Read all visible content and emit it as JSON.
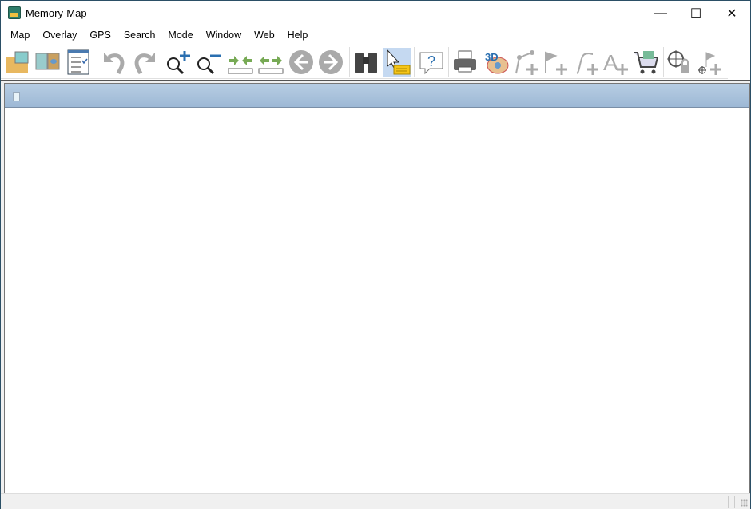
{
  "window": {
    "title": "Memory-Map",
    "minimize": "—",
    "maximize": "☐",
    "close": "✕"
  },
  "menu": [
    "Map",
    "Overlay",
    "GPS",
    "Search",
    "Mode",
    "Window",
    "Web",
    "Help"
  ],
  "toolbar": [
    {
      "name": "open-folder-icon"
    },
    {
      "name": "map-compare-icon"
    },
    {
      "name": "checklist-icon"
    },
    {
      "name": "undo-icon"
    },
    {
      "name": "redo-icon"
    },
    {
      "name": "zoom-in-icon"
    },
    {
      "name": "zoom-out-icon"
    },
    {
      "name": "scale-in-icon"
    },
    {
      "name": "scale-out-icon"
    },
    {
      "name": "back-icon"
    },
    {
      "name": "forward-icon"
    },
    {
      "name": "binoculars-icon"
    },
    {
      "name": "select-pointer-icon",
      "active": true
    },
    {
      "name": "help-icon"
    },
    {
      "name": "print-icon"
    },
    {
      "name": "3d-view-icon"
    },
    {
      "name": "add-route-icon"
    },
    {
      "name": "add-mark-icon"
    },
    {
      "name": "add-track-icon"
    },
    {
      "name": "add-text-icon"
    },
    {
      "name": "shop-cart-icon"
    },
    {
      "name": "position-lock-icon"
    },
    {
      "name": "add-mark-at-position-icon"
    }
  ],
  "colors": {
    "accent": "#c5d9f1",
    "window_border": "#2b4f66",
    "child_title": "#a9c2dc"
  }
}
